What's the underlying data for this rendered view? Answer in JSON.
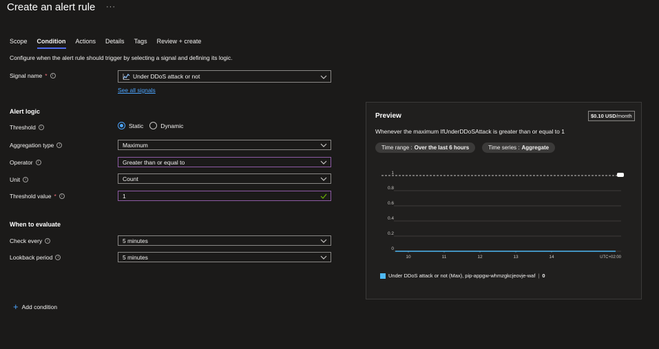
{
  "header": {
    "title": "Create an alert rule",
    "more": "···"
  },
  "tabs": [
    {
      "label": "Scope"
    },
    {
      "label": "Condition"
    },
    {
      "label": "Actions"
    },
    {
      "label": "Details"
    },
    {
      "label": "Tags"
    },
    {
      "label": "Review + create"
    }
  ],
  "description": "Configure when the alert rule should trigger by selecting a signal and defining its logic.",
  "signal": {
    "label": "Signal name",
    "required": "*",
    "value": "Under DDoS attack or not",
    "see_all": "See all signals"
  },
  "alert_logic": {
    "heading": "Alert logic",
    "threshold_label": "Threshold",
    "threshold_options": [
      "Static",
      "Dynamic"
    ],
    "threshold_selected": "Static",
    "aggregation_label": "Aggregation type",
    "aggregation_value": "Maximum",
    "operator_label": "Operator",
    "operator_value": "Greater than or equal to",
    "unit_label": "Unit",
    "unit_value": "Count",
    "threshold_value_label": "Threshold value",
    "threshold_value": "1"
  },
  "evaluate": {
    "heading": "When to evaluate",
    "check_every_label": "Check every",
    "check_every_value": "5 minutes",
    "lookback_label": "Lookback period",
    "lookback_value": "5 minutes"
  },
  "add_condition": "Add condition",
  "preview": {
    "title": "Preview",
    "price_amount": "$0.10 USD",
    "price_unit": "/month",
    "description": "Whenever the maximum IfUnderDDoSAttack is greater than or equal to 1",
    "time_range_label": "Time range :",
    "time_range_value": "Over the last 6 hours",
    "time_series_label": "Time series :",
    "time_series_value": "Aggregate",
    "legend_label": "Under DDoS attack or not (Max), pip-appgw-whmzgkcjeovje-waf",
    "legend_value": "0"
  },
  "chart_data": {
    "type": "line",
    "x_ticks": [
      "10",
      "11",
      "12",
      "13",
      "14"
    ],
    "x_unit_label": "UTC+02:00",
    "y_ticks": [
      "0",
      "0.2",
      "0.4",
      "0.6",
      "0.8",
      "1"
    ],
    "ylim": [
      0,
      1
    ],
    "threshold": 1,
    "series": [
      {
        "name": "Under DDoS attack or not (Max), pip-appgw-whmzgkcjeovje-waf",
        "values": [
          0,
          0,
          0,
          0,
          0,
          0
        ]
      }
    ],
    "grid": true,
    "legend_position": "bottom-left",
    "series_color": "#4fb9f5"
  }
}
